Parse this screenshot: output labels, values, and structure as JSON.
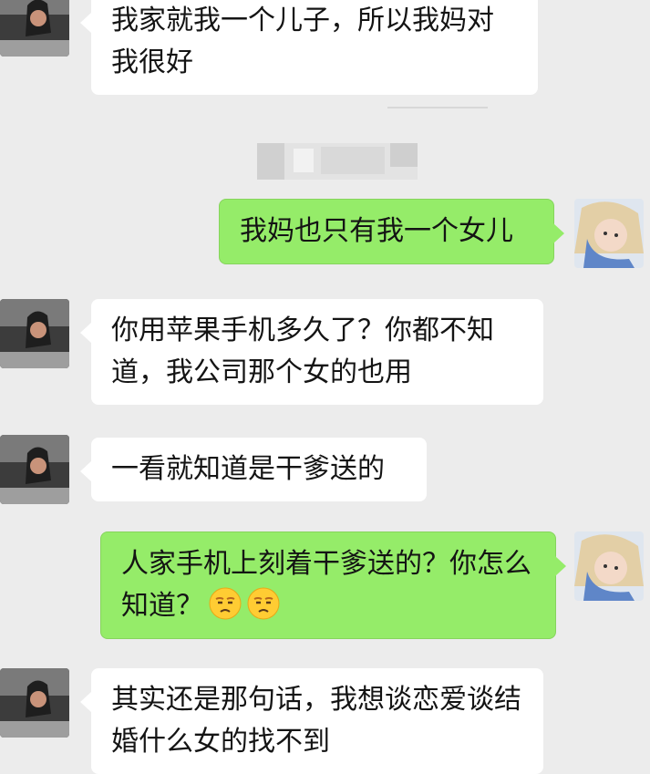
{
  "messages": [
    {
      "side": "in",
      "text": "我家就我一个儿子，所以我妈对我很好"
    },
    {
      "side": "out",
      "text": "我妈也只有我一个女儿"
    },
    {
      "side": "in",
      "text": "你用苹果手机多久了？你都不知道，我公司那个女的也用"
    },
    {
      "side": "in",
      "text": "一看就知道是干爹送的"
    },
    {
      "side": "out",
      "text": "人家手机上刻着干爹送的？你怎么知道？",
      "emoji": [
        "unamused-face-icon",
        "unamused-face-icon"
      ]
    },
    {
      "side": "in",
      "text": "其实还是那句话，我想谈恋爱谈结婚什么女的找不到"
    }
  ],
  "colors": {
    "background": "#ececec",
    "incoming_bubble": "#ffffff",
    "outgoing_bubble": "#95ec69",
    "text": "#141414"
  }
}
